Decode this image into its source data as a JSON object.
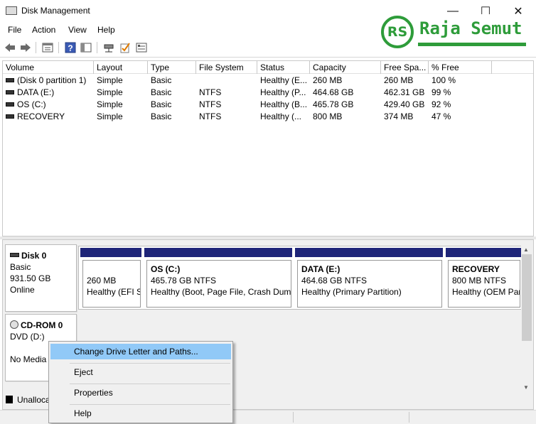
{
  "window": {
    "title": "Disk Management",
    "minimize_glyph": "—",
    "maximize_glyph": "☐",
    "close_glyph": "✕"
  },
  "menu": [
    "File",
    "Action",
    "View",
    "Help"
  ],
  "toolbar": {
    "icons": [
      "back-icon",
      "forward-icon",
      "properties-icon",
      "help-icon",
      "show-hide-icon",
      "connect-icon",
      "check-icon",
      "settings-icon"
    ]
  },
  "logo": {
    "initials": "RS",
    "name": "Raja Semut",
    "color": "#2e9c3a"
  },
  "volume_table": {
    "columns": [
      "Volume",
      "Layout",
      "Type",
      "File System",
      "Status",
      "Capacity",
      "Free Spa...",
      "% Free"
    ],
    "rows": [
      [
        "(Disk 0 partition 1)",
        "Simple",
        "Basic",
        "",
        "Healthy (E...",
        "260 MB",
        "260 MB",
        "100 %"
      ],
      [
        "DATA (E:)",
        "Simple",
        "Basic",
        "NTFS",
        "Healthy (P...",
        "464.68 GB",
        "462.31 GB",
        "99 %"
      ],
      [
        "OS (C:)",
        "Simple",
        "Basic",
        "NTFS",
        "Healthy (B...",
        "465.78 GB",
        "429.40 GB",
        "92 %"
      ],
      [
        "RECOVERY",
        "Simple",
        "Basic",
        "NTFS",
        "Healthy (...",
        "800 MB",
        "374 MB",
        "47 %"
      ]
    ]
  },
  "disk0": {
    "name": "Disk 0",
    "type": "Basic",
    "size": "931.50 GB",
    "status": "Online",
    "partitions": [
      {
        "title": "",
        "size": "260 MB",
        "status": "Healthy (EFI Sy"
      },
      {
        "title": "OS  (C:)",
        "size": "465.78 GB NTFS",
        "status": "Healthy (Boot, Page File, Crash Dump"
      },
      {
        "title": "DATA  (E:)",
        "size": "464.68 GB NTFS",
        "status": "Healthy (Primary Partition)"
      },
      {
        "title": "RECOVERY",
        "size": "800 MB NTFS",
        "status": "Healthy (OEM Par"
      }
    ]
  },
  "cdrom": {
    "name": "CD-ROM 0",
    "drive": "DVD (D:)",
    "media": "No Media"
  },
  "legend": {
    "unallocated": "Unalloca"
  },
  "context_menu": {
    "items": [
      "Change Drive Letter and Paths...",
      "Eject",
      "Properties",
      "Help"
    ],
    "highlighted_index": 0
  },
  "colors": {
    "partition_bar": "#1e2478",
    "menu_highlight": "#91c9f7"
  }
}
